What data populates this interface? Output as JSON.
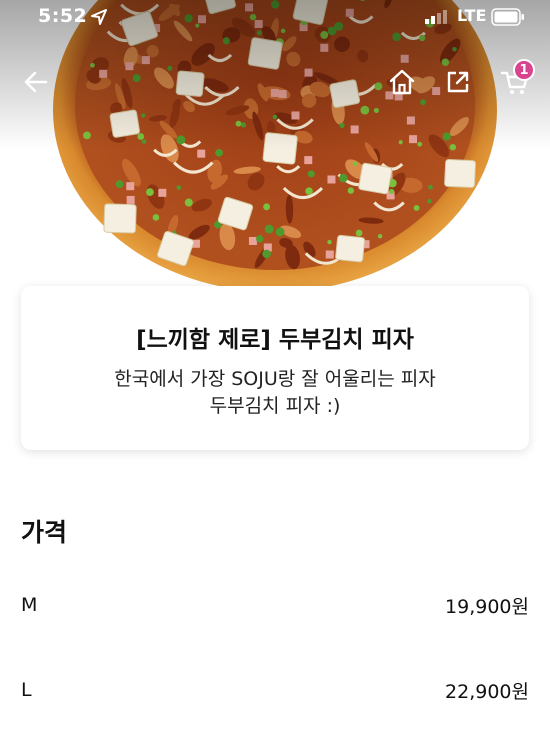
{
  "status_bar": {
    "time": "5:52",
    "network": "LTE"
  },
  "header": {
    "back_icon": "arrow-left-icon",
    "home_icon": "home-icon",
    "share_icon": "share-icon",
    "cart_icon": "cart-icon",
    "cart_count": "1",
    "cart_badge_color": "#d9448e"
  },
  "product": {
    "title": "[느끼함 제로] 두부김치 피자",
    "description_line1": "한국에서 가장 SOJU랑 잘 어울리는 피자",
    "description_line2": "두부김치 피자 :)"
  },
  "price_section": {
    "title": "가격",
    "options": [
      {
        "size": "M",
        "price": "19,900원"
      },
      {
        "size": "L",
        "price": "22,900원"
      }
    ]
  }
}
